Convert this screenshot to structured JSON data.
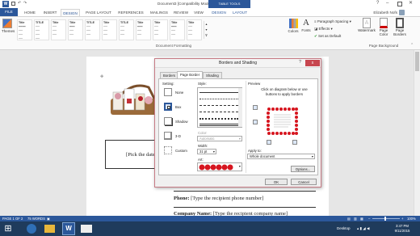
{
  "window": {
    "title": "Document3 [Compatibility Mode] - Word",
    "context_tab_group": "TABLE TOOLS",
    "user": "Elizabeth Nofs"
  },
  "tabs": [
    "FILE",
    "HOME",
    "INSERT",
    "DESIGN",
    "PAGE LAYOUT",
    "REFERENCES",
    "MAILINGS",
    "REVIEW",
    "VIEW",
    "DESIGN",
    "LAYOUT"
  ],
  "ribbon": {
    "themes_label": "Themes",
    "styles": [
      "Title",
      "TITLE",
      "Title",
      "Title",
      "TITLE",
      "Title",
      "TITLE",
      "Title",
      "Title",
      "Title",
      "Title"
    ],
    "colors_label": "Colors",
    "fonts_label": "Fonts",
    "paragraph_spacing": "Paragraph Spacing",
    "effects": "Effects",
    "set_as_default": "Set as Default",
    "watermark": "Watermark",
    "page_color": "Page Color",
    "page_borders": "Page Borders",
    "group_document_formatting": "Document Formatting",
    "group_page_background": "Page Background"
  },
  "document": {
    "date_placeholder": "[Pick the date]",
    "phone_label": "Phone:",
    "phone_placeholder": "[Type the recipient phone number]",
    "company_label": "Company Name:",
    "company_placeholder": "[Type the recipient company name]"
  },
  "dialog": {
    "title": "Borders and Shading",
    "help": "?",
    "close": "x",
    "tabs": [
      "Borders",
      "Page Border",
      "Shading"
    ],
    "active_tab": "Page Border",
    "setting_label": "Setting:",
    "settings": [
      "None",
      "Box",
      "Shadow",
      "3-D",
      "Custom"
    ],
    "style_label": "Style:",
    "color_label": "Color:",
    "color_value": "Automatic",
    "width_label": "Width:",
    "width_value": "31 pt",
    "art_label": "Art:",
    "preview_label": "Preview",
    "preview_hint": "Click on diagram below or use buttons to apply borders",
    "apply_to_label": "Apply to:",
    "apply_to_value": "Whole document",
    "options_button": "Options...",
    "ok_button": "OK",
    "cancel_button": "Cancel",
    "art_color": "#d6151f"
  },
  "status": {
    "page": "PAGE 1 OF 2",
    "words": "75 WORDS",
    "zoom": "100%"
  },
  "taskbar": {
    "desktop_label": "Desktop",
    "time": "3:47 PM",
    "date": "9/11/2015"
  }
}
